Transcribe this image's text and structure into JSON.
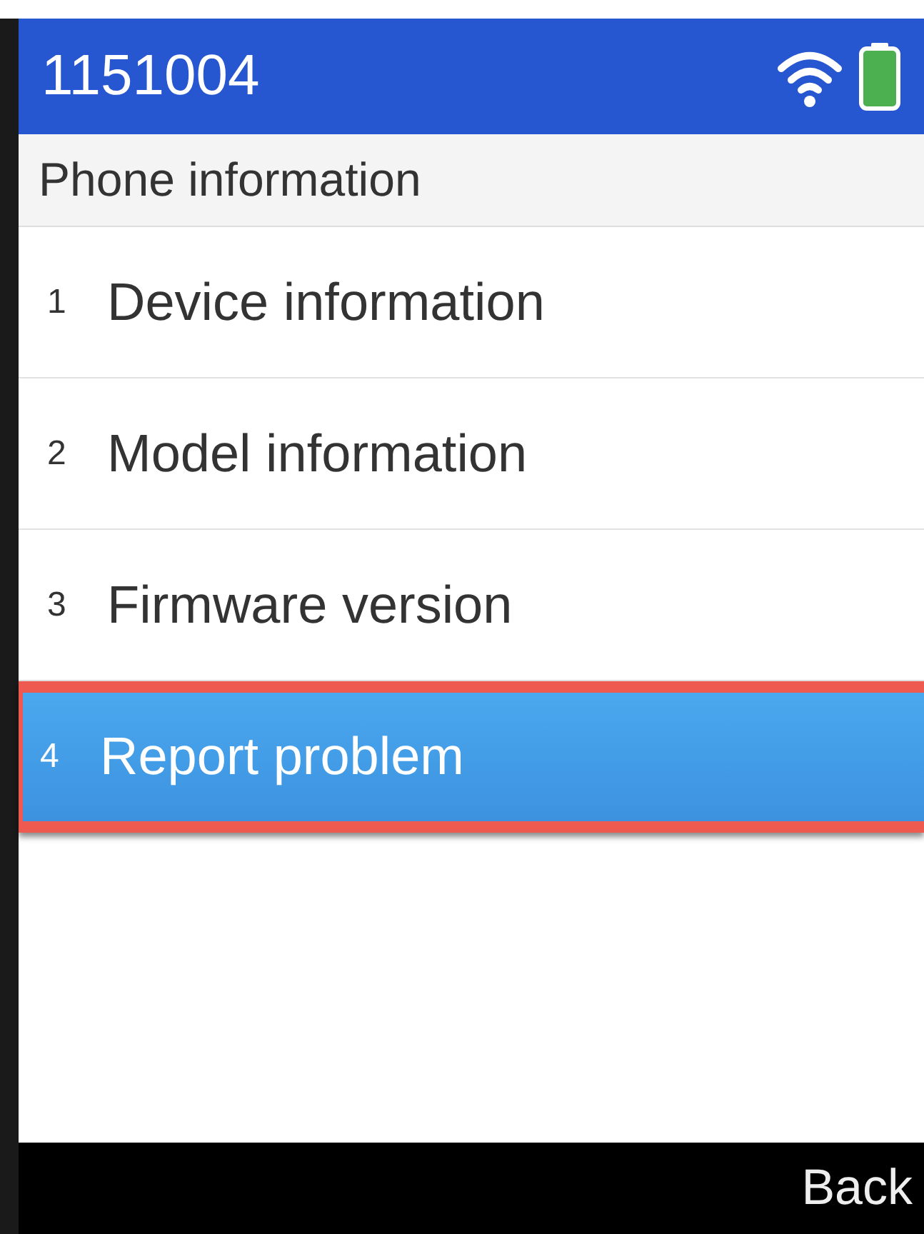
{
  "status_bar": {
    "title": "1151004"
  },
  "header": {
    "title": "Phone information"
  },
  "menu": [
    {
      "number": "1",
      "label": "Device information",
      "selected": false,
      "highlighted": false
    },
    {
      "number": "2",
      "label": "Model information",
      "selected": false,
      "highlighted": false
    },
    {
      "number": "3",
      "label": "Firmware version",
      "selected": false,
      "highlighted": false
    },
    {
      "number": "4",
      "label": "Report problem",
      "selected": true,
      "highlighted": true
    }
  ],
  "softkeys": [
    "Back"
  ]
}
